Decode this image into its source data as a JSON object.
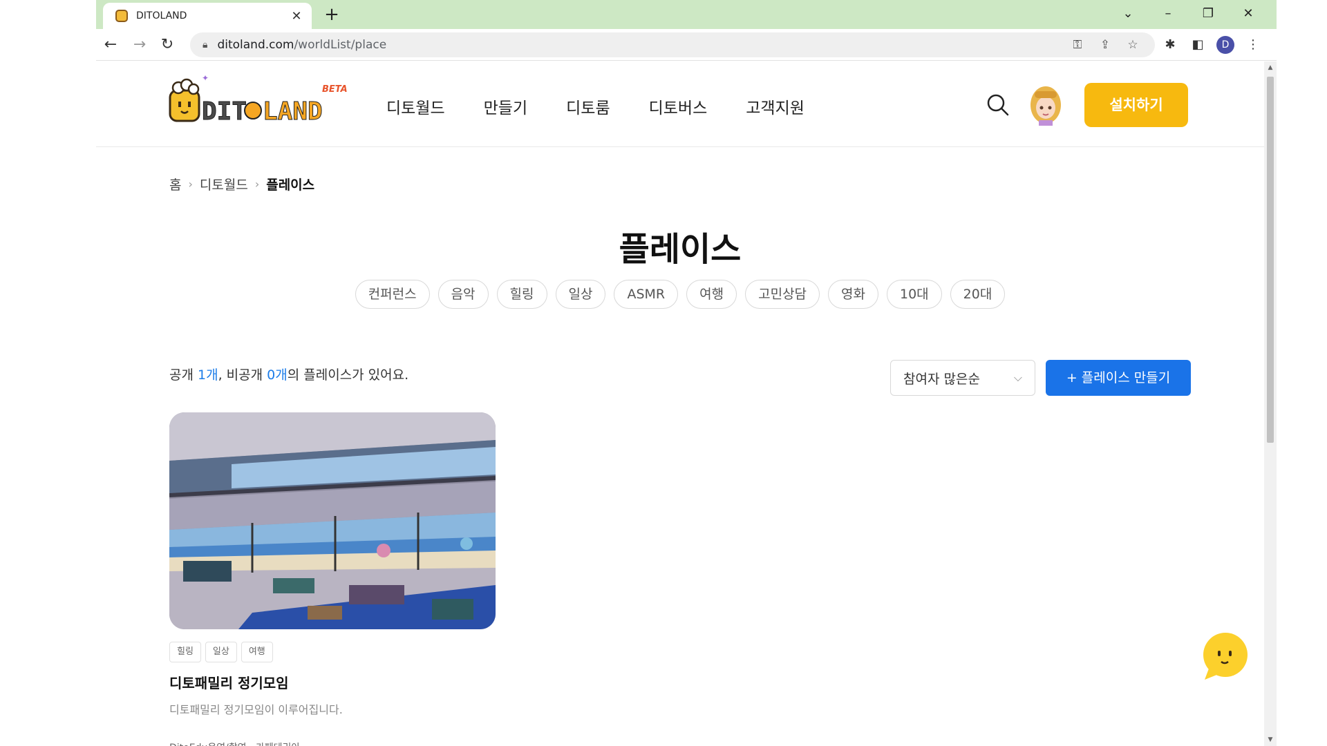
{
  "browser": {
    "tab_title": "DITOLAND",
    "tab_close": "✕",
    "new_tab": "+",
    "win_controls": [
      "⌄",
      "–",
      "❐",
      "✕"
    ],
    "url_host": "ditoland.com",
    "url_path": "/worldList/place",
    "profile_letter": "D"
  },
  "header": {
    "logo_beta": "BETA",
    "nav": [
      "디토월드",
      "만들기",
      "디토룸",
      "디토버스",
      "고객지원"
    ],
    "install_label": "설치하기"
  },
  "breadcrumb": [
    "홈",
    "디토월드",
    "플레이스"
  ],
  "page_title": "플레이스",
  "chips": [
    "컨퍼런스",
    "음악",
    "힐링",
    "일상",
    "ASMR",
    "여행",
    "고민상담",
    "영화",
    "10대",
    "20대"
  ],
  "list": {
    "count_prefix": "공개 ",
    "public_count": "1개",
    "count_mid": ", 비공개 ",
    "private_count": "0개",
    "count_suffix": "의 플레이스가 있어요.",
    "sort_label": "참여자 많은순",
    "create_label": "+ 플레이스 만들기"
  },
  "card": {
    "tags": [
      "힐링",
      "일상",
      "여행"
    ],
    "title": "디토패밀리 정기모임",
    "description": "디토패밀리 정기모임이 이루어집니다.",
    "meta": "DitoEdu운영/촬영 · 카페테리아"
  },
  "colors": {
    "tabstrip": "#cde8c4",
    "accent_yellow": "#f7b90f",
    "accent_blue": "#1a73e8",
    "link_blue": "#1b7ce8"
  }
}
